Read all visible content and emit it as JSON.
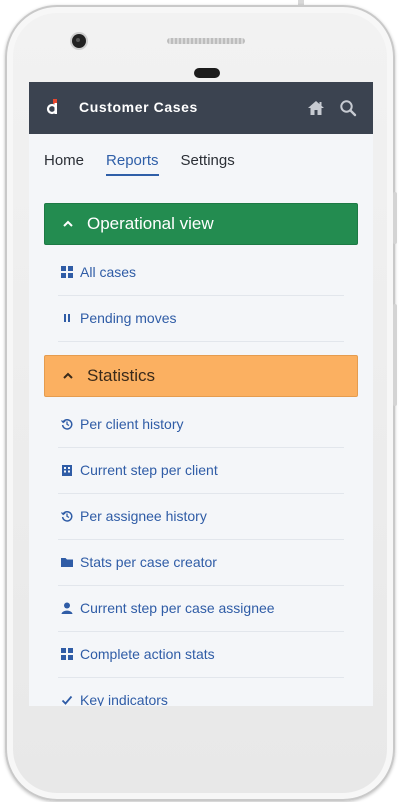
{
  "app": {
    "title": "Customer Cases"
  },
  "tabs": [
    {
      "label": "Home",
      "active": false
    },
    {
      "label": "Reports",
      "active": true
    },
    {
      "label": "Settings",
      "active": false
    }
  ],
  "sections": [
    {
      "title": "Operational view",
      "color": "#238c50",
      "items": [
        {
          "label": "All cases",
          "icon": "grid-icon"
        },
        {
          "label": "Pending moves",
          "icon": "pause-icon"
        }
      ]
    },
    {
      "title": "Statistics",
      "color": "#fbb061",
      "items": [
        {
          "label": "Per client history",
          "icon": "history-icon"
        },
        {
          "label": "Current step per client",
          "icon": "building-icon"
        },
        {
          "label": "Per assignee history",
          "icon": "history-icon"
        },
        {
          "label": "Stats per case creator",
          "icon": "folder-icon"
        },
        {
          "label": "Current step per case assignee",
          "icon": "user-icon"
        },
        {
          "label": "Complete action stats",
          "icon": "grid-icon"
        },
        {
          "label": "Key indicators",
          "icon": "check-icon"
        }
      ]
    }
  ],
  "colors": {
    "appbar": "#3b4350",
    "link": "#2f5ca6",
    "accent": "#2f5fa8"
  }
}
